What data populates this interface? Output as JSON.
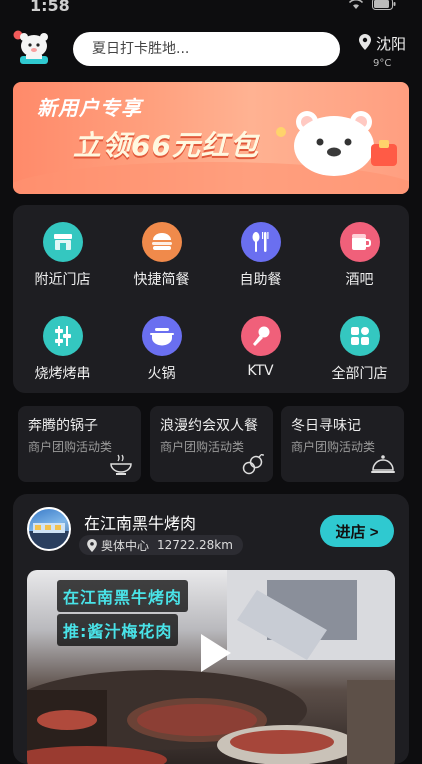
{
  "status": {
    "time": "1:58"
  },
  "search": {
    "placeholder": "夏日打卡胜地..."
  },
  "location": {
    "city": "沈阳",
    "temperature": "9°C"
  },
  "banner": {
    "line1": "新用户专享",
    "line2": "立领66元红包"
  },
  "categories": [
    {
      "label": "附近门店",
      "icon": "store-icon",
      "color": "#34c7c0"
    },
    {
      "label": "快捷简餐",
      "icon": "burger-icon",
      "color": "#f08a4b"
    },
    {
      "label": "自助餐",
      "icon": "fork-knife-icon",
      "color": "#6a6ff0"
    },
    {
      "label": "酒吧",
      "icon": "cocktail-icon",
      "color": "#f0607a"
    },
    {
      "label": "烧烤烤串",
      "icon": "skewer-icon",
      "color": "#34c7c0"
    },
    {
      "label": "火锅",
      "icon": "hotpot-icon",
      "color": "#6a6ff0"
    },
    {
      "label": "KTV",
      "icon": "microphone-icon",
      "color": "#f0607a"
    },
    {
      "label": "全部门店",
      "icon": "grid-icon",
      "color": "#34c7c0"
    }
  ],
  "deals": [
    {
      "title": "奔腾的锅子",
      "subtitle": "商户团购活动类",
      "icon": "bowl-icon"
    },
    {
      "title": "浪漫约会双人餐",
      "subtitle": "商户团购活动类",
      "icon": "couple-icon"
    },
    {
      "title": "冬日寻味记",
      "subtitle": "商户团购活动类",
      "icon": "cloche-icon"
    }
  ],
  "store": {
    "name": "在江南黑牛烤肉",
    "area": "奥体中心",
    "distance": "12722.28km",
    "enter_label": "进店 >",
    "video_tag1": "在江南黑牛烤肉",
    "video_tag2": "推:酱汁梅花肉"
  }
}
